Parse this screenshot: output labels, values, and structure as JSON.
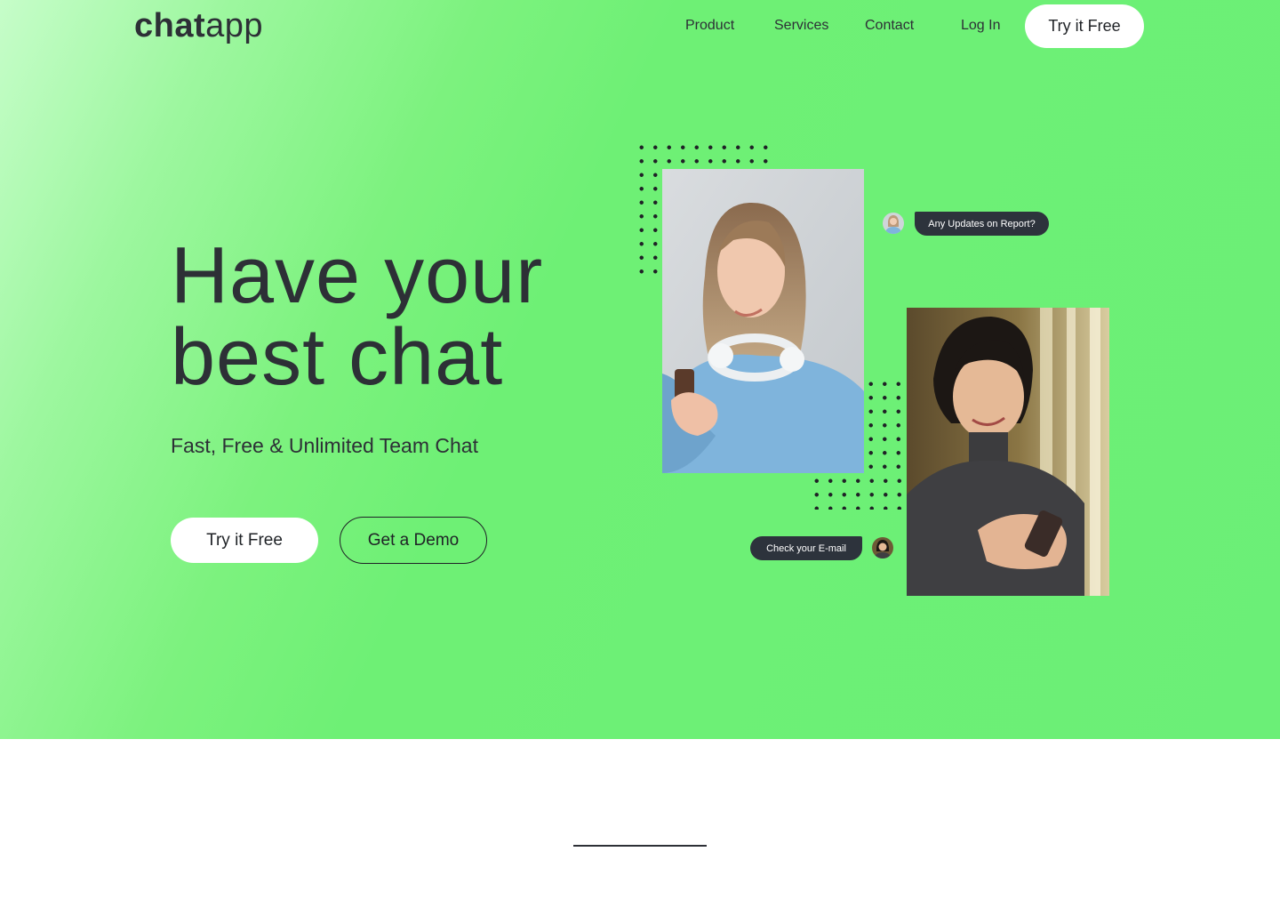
{
  "logo": {
    "bold": "chat",
    "light": "app"
  },
  "nav": {
    "items": [
      "Product",
      "Services",
      "Contact"
    ],
    "login": "Log In",
    "cta": "Try it Free"
  },
  "hero": {
    "headline_line1": "Have your",
    "headline_line2": "best chat",
    "subtitle": "Fast, Free & Unlimited Team Chat",
    "cta_primary": "Try it Free",
    "cta_secondary": "Get a Demo"
  },
  "chat_bubbles": {
    "top": "Any Updates on Report?",
    "bottom": "Check your E-mail"
  },
  "colors": {
    "hero_green": "#6bef77",
    "hero_light": "#c6fdc9",
    "text_dark": "#2d3036",
    "bubble": "#2d333c"
  },
  "icons": [
    "avatar-woman-1",
    "avatar-woman-2"
  ]
}
